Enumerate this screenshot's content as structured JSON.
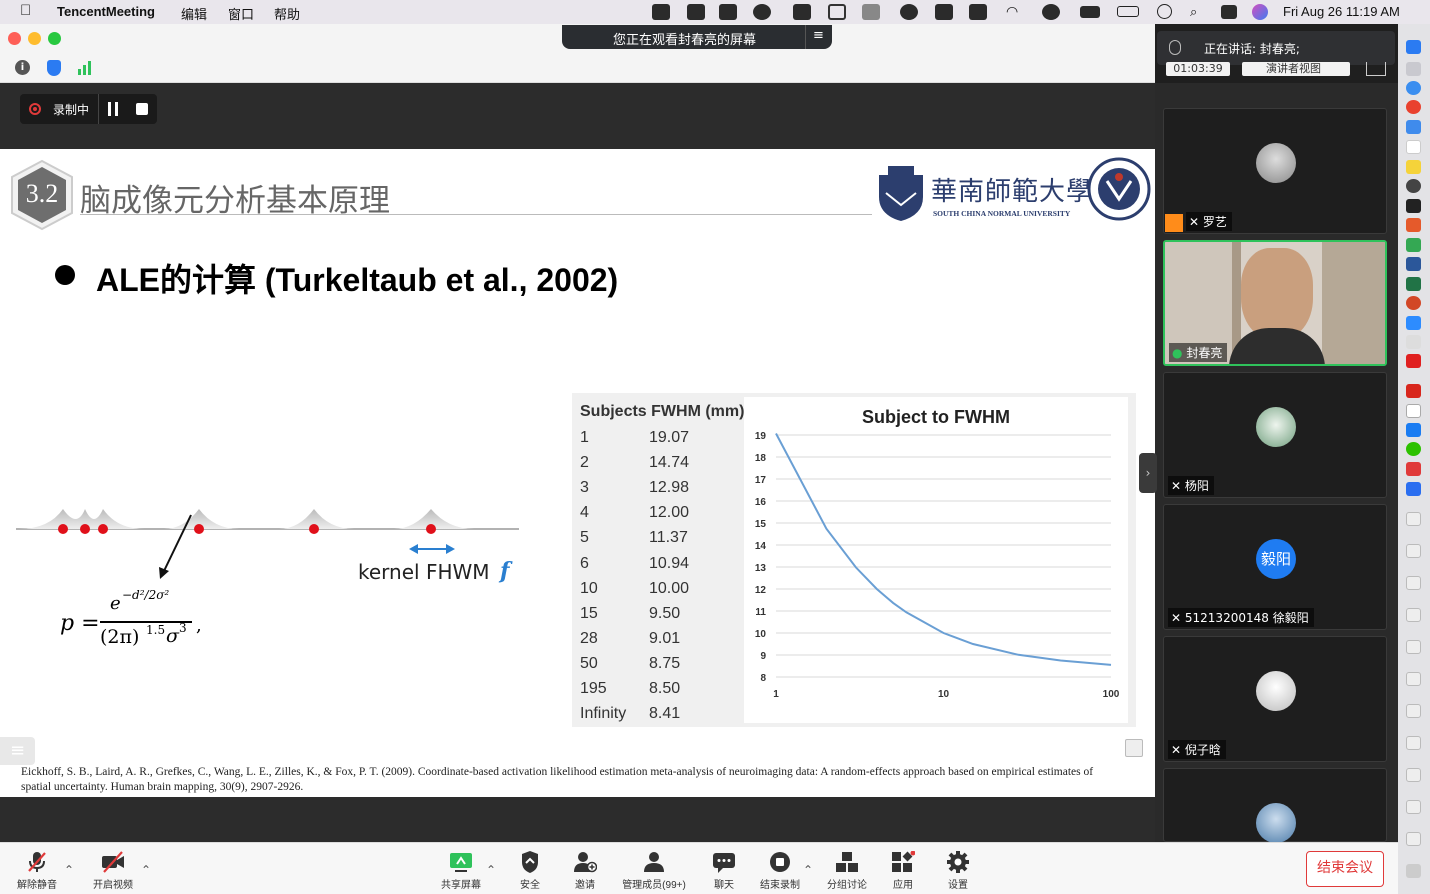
{
  "menubar": {
    "app_name": "TencentMeeting",
    "menu_items": [
      "编辑",
      "窗口",
      "帮助"
    ],
    "datetime": "Fri Aug 26  11:19 AM"
  },
  "window": {
    "share_banner": "您正在观看封春亮的屏幕",
    "speaking": "正在讲话: 封春亮;",
    "timer": "01:03:39",
    "view_mode": "演讲者视图"
  },
  "recording": {
    "label": "录制中"
  },
  "slide": {
    "section_number": "3.2",
    "title": "脑成像元分析基本原理",
    "university_cn": "華南師範大學",
    "university_en": "SOUTH CHINA NORMAL UNIVERSITY",
    "bullet": "ALE的计算 (Turkeltaub et al., 2002)",
    "kernel_label": "kernel FHWM",
    "kernel_symbol": "f",
    "formula_p": "p =",
    "formula_num": "e",
    "formula_num_exp": "−d²/2σ²",
    "formula_den": "(2π)",
    "formula_den_exp": "1.5",
    "formula_sigma": "σ",
    "formula_sigma_exp": "3",
    "table_header_subjects": "Subjects",
    "table_header_fwhm": "FWHM (mm)",
    "table_rows": [
      [
        "1",
        "19.07"
      ],
      [
        "2",
        "14.74"
      ],
      [
        "3",
        "12.98"
      ],
      [
        "4",
        "12.00"
      ],
      [
        "5",
        "11.37"
      ],
      [
        "6",
        "10.94"
      ],
      [
        "10",
        "10.00"
      ],
      [
        "15",
        "9.50"
      ],
      [
        "28",
        "9.01"
      ],
      [
        "50",
        "8.75"
      ],
      [
        "195",
        "8.50"
      ],
      [
        "Infinity",
        "8.41"
      ]
    ],
    "reference": "Eickhoff, S. B., Laird, A. R., Grefkes, C., Wang, L. E., Zilles, K., & Fox, P. T. (2009). Coordinate-based activation likelihood estimation meta-analysis of neuroimaging data: A random-effects approach based on empirical estimates of spatial uncertainty. Human brain mapping, 30(9), 2907-2926."
  },
  "chart_data": {
    "type": "line",
    "title": "Subject to FWHM",
    "xscale": "log",
    "x_ticks": [
      "1",
      "10",
      "100"
    ],
    "y_ticks": [
      "8",
      "9",
      "10",
      "11",
      "12",
      "13",
      "14",
      "15",
      "16",
      "17",
      "18",
      "19"
    ],
    "ylim": [
      8,
      19
    ],
    "xlim": [
      1,
      100
    ],
    "grid": true,
    "series": [
      {
        "x": [
          1,
          2,
          3,
          4,
          5,
          6,
          10,
          15,
          28,
          50,
          100
        ],
        "y": [
          19.07,
          14.74,
          12.98,
          12.0,
          11.37,
          10.94,
          10.0,
          9.5,
          9.01,
          8.75,
          8.55
        ]
      }
    ],
    "line_color": "#6a9fd4"
  },
  "participants": [
    {
      "name": "罗艺"
    },
    {
      "name": "封春亮"
    },
    {
      "name": "杨阳"
    },
    {
      "name": "51213200148 徐毅阳",
      "avatar_text": "毅阳"
    },
    {
      "name": "倪子晗"
    }
  ],
  "bottom_toolbar": {
    "unmute": "解除静音",
    "start_video": "开启视频",
    "share_screen": "共享屏幕",
    "security": "安全",
    "invite": "邀请",
    "manage": "管理成员(99+)",
    "chat": "聊天",
    "stop_record": "结束录制",
    "breakout": "分组讨论",
    "apps": "应用",
    "settings": "设置",
    "end_meeting": "结束会议"
  },
  "colors": {
    "accent_green": "#2fc25b",
    "end_red": "#e03a3a",
    "record_red": "#e03a3a",
    "avatar_blue": "#1f7cf2"
  }
}
